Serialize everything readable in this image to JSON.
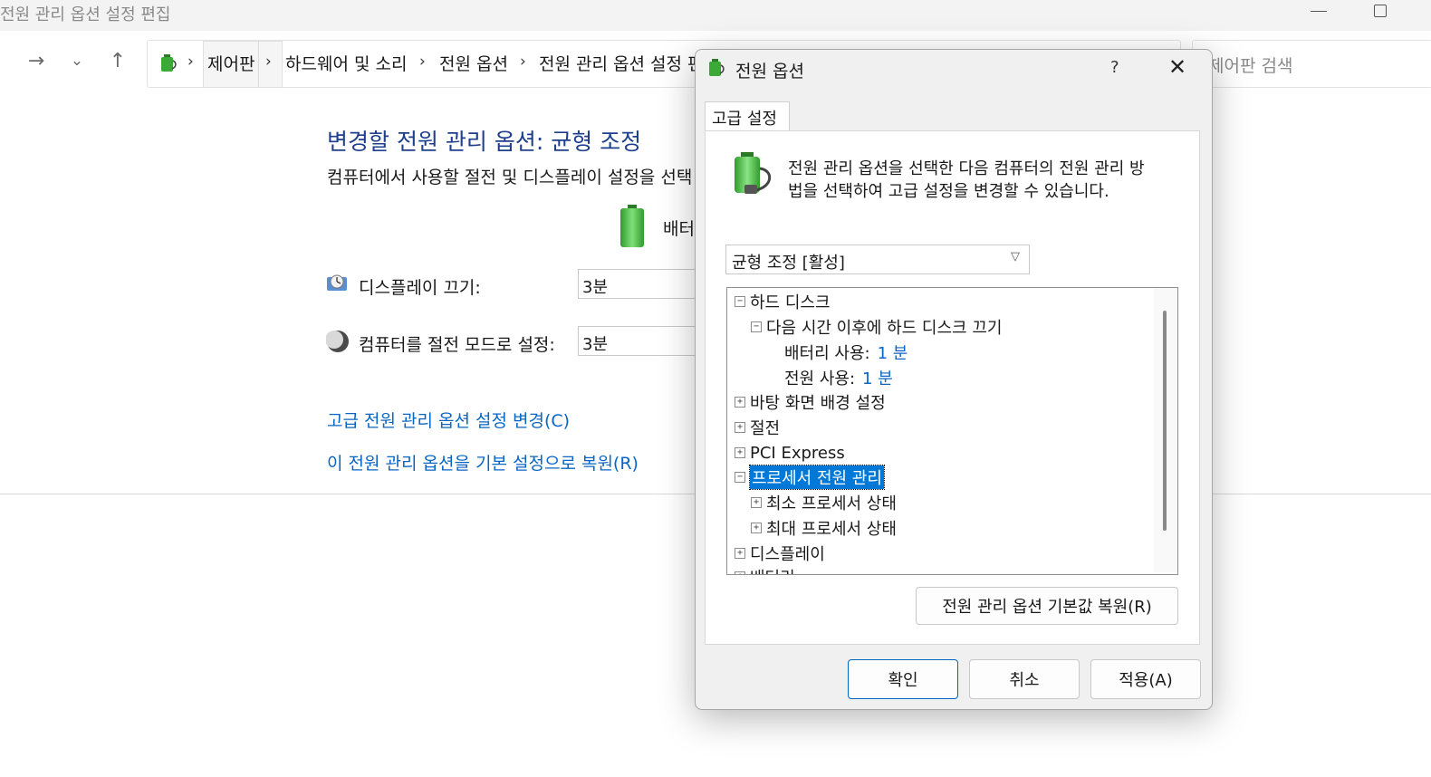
{
  "window": {
    "title": "전원 관리 옵션 설정 편집"
  },
  "nav": {
    "breadcrumbs": [
      "제어판",
      "하드웨어 및 소리",
      "전원 옵션",
      "전원 관리 옵션 설정 편"
    ],
    "search_placeholder": "제어판 검색"
  },
  "background": {
    "heading": "변경할 전원 관리 옵션: 균형 조정",
    "subtitle": "컴퓨터에서 사용할 절전 및 디스플레이 설정을 선택",
    "battery_label": "배터",
    "display_off_label": "디스플레이 끄기:",
    "display_off_value": "3분",
    "sleep_label": "컴퓨터를 절전 모드로 설정:",
    "sleep_value": "3분",
    "advanced_link": "고급 전원 관리 옵션 설정 변경(C)",
    "restore_link": "이 전원 관리 옵션을 기본 설정으로 복원(R)"
  },
  "dialog": {
    "title": "전원 옵션",
    "help_glyph": "?",
    "close_glyph": "✕",
    "tab": "고급 설정",
    "description_line1": "전원 관리 옵션을 선택한 다음 컴퓨터의 전원 관리 방",
    "description_line2": "법을 선택하여 고급 설정을 변경할 수 있습니다.",
    "plan_selected": "균형 조정 [활성]",
    "tree": {
      "hard_disk": "하드 디스크",
      "turn_off_after": "다음 시간 이후에 하드 디스크 끄기",
      "on_battery_label": "배터리 사용:",
      "on_battery_value": "1 분",
      "plugged_in_label": "전원 사용:",
      "plugged_in_value": "1 분",
      "desktop_background": "바탕 화면 배경 설정",
      "sleep": "절전",
      "pci_express": "PCI Express",
      "processor_power": "프로세서 전원 관리",
      "min_processor": "최소 프로세서 상태",
      "max_processor": "최대 프로세서 상태",
      "display": "디스플레이",
      "battery_cut": "배터리"
    },
    "restore_defaults": "전원 관리 옵션 기본값 복원(R)",
    "ok": "확인",
    "cancel": "취소",
    "apply": "적용(A)"
  }
}
